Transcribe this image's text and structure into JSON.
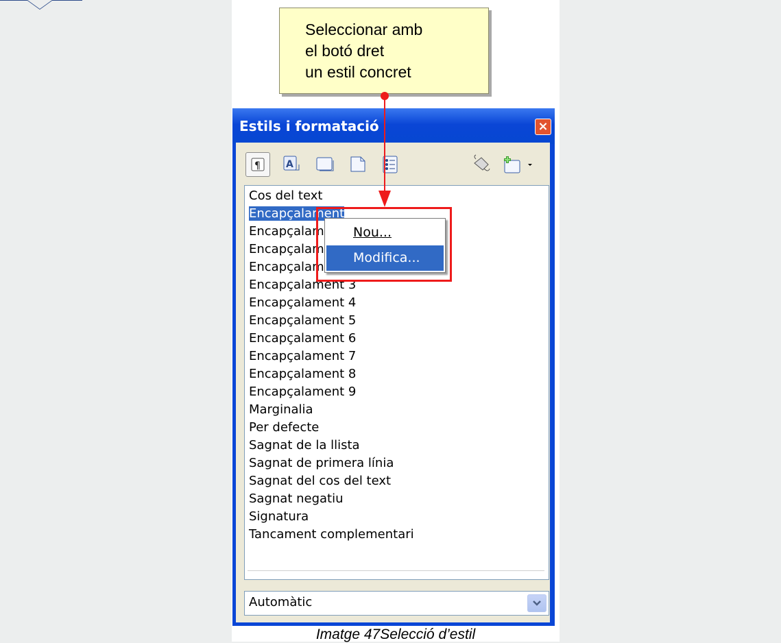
{
  "callout": {
    "lines": [
      "Seleccionar amb",
      "el botó dret",
      "un estil concret"
    ]
  },
  "window": {
    "title": "Estils i formatació",
    "close_glyph": "×"
  },
  "toolbar": {
    "icons": [
      "paragraph-styles-icon",
      "character-styles-icon",
      "frame-styles-icon",
      "page-styles-icon",
      "list-styles-icon",
      "fill-format-icon",
      "new-style-icon",
      "dropdown-arrow-icon"
    ]
  },
  "styles_list": {
    "items": [
      "Cos del text",
      "Encapçalament",
      "Encapçalament 1",
      "Encapçalament 10",
      "Encapçalament 2",
      "Encapçalament 3",
      "Encapçalament 4",
      "Encapçalament 5",
      "Encapçalament 6",
      "Encapçalament 7",
      "Encapçalament 8",
      "Encapçalament 9",
      "Marginalia",
      "Per defecte",
      "Sagnat de la llista",
      "Sagnat de primera línia",
      "Sagnat del cos del text",
      "Sagnat negatiu",
      "Signatura",
      "Tancament complementari"
    ],
    "selected_index": 1
  },
  "context_menu": {
    "new_label": "Nou...",
    "modify_label": "Modifica..."
  },
  "filter": {
    "value": "Automàtic"
  },
  "caption": "Imatge 47Selecció d’estil",
  "colors": {
    "titlebar": "#0a46d6",
    "selection": "#316ac5",
    "highlight": "#ee1b1b",
    "callout": "#ffffc8"
  }
}
